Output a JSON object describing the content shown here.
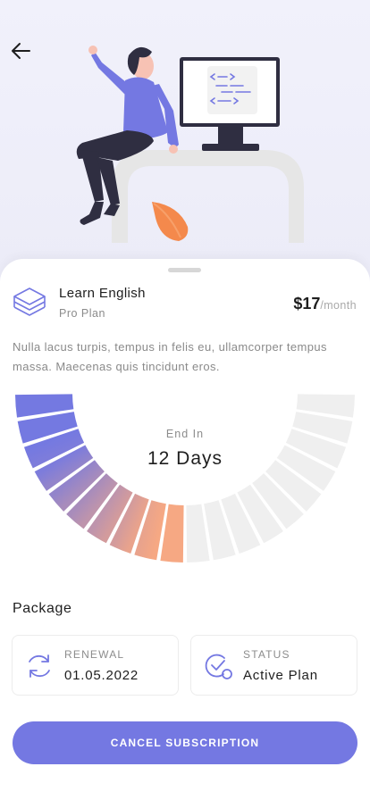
{
  "header": {
    "back_icon": "arrow-left-icon"
  },
  "plan": {
    "icon": "layers-icon",
    "title": "Learn English",
    "subtitle": "Pro Plan",
    "price": "$17",
    "price_unit": "/month",
    "description": "Nulla lacus turpis, tempus in felis eu, ullamcorper tempus massa. Maecenas quis tincidunt eros."
  },
  "countdown": {
    "label": "End In",
    "value": "12 Days",
    "total_segments": 20,
    "elapsed_segments": 10,
    "colors": {
      "start": "#7479e1",
      "end": "#f6a883",
      "remaining": "#efefef"
    }
  },
  "package": {
    "title": "Package",
    "renewal": {
      "icon": "refresh-icon",
      "label": "RENEWAL",
      "value": "01.05.2022"
    },
    "status": {
      "icon": "check-status-icon",
      "label": "STATUS",
      "value": "Active Plan"
    }
  },
  "actions": {
    "cancel_label": "CANCEL SUBSCRIPTION"
  },
  "theme": {
    "accent": "#7478e2",
    "leaf": "#f4894c"
  }
}
